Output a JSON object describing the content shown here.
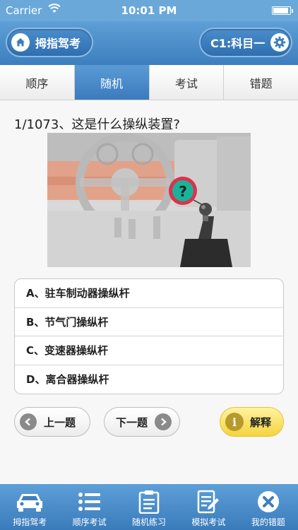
{
  "status_bar": {
    "carrier": "Carrier",
    "time": "10:01 PM"
  },
  "header": {
    "home_label": "拇指驾考",
    "license_label": "C1:科目一"
  },
  "tabs": [
    {
      "label": "顺序",
      "active": false
    },
    {
      "label": "随机",
      "active": true
    },
    {
      "label": "考试",
      "active": false
    },
    {
      "label": "错题",
      "active": false
    }
  ],
  "question": {
    "text": "1/1073、这是什么操纵装置?",
    "options": [
      "A、驻车制动器操纵杆",
      "B、节气门操纵杆",
      "C、变速器操纵杆",
      "D、离合器操纵杆"
    ]
  },
  "buttons": {
    "prev": "上一题",
    "next": "下一题",
    "explain": "解释"
  },
  "bottom_nav": [
    {
      "label": "拇指驾考",
      "icon": "car-icon"
    },
    {
      "label": "顺序考试",
      "icon": "list-icon"
    },
    {
      "label": "随机练习",
      "icon": "clipboard-icon"
    },
    {
      "label": "模拟考试",
      "icon": "edit-document-icon"
    },
    {
      "label": "我的错题",
      "icon": "close-circle-icon"
    }
  ],
  "colors": {
    "primary_blue": "#3d7fbe",
    "explain_yellow": "#f4d43e",
    "question_marker": "#e0304a"
  }
}
